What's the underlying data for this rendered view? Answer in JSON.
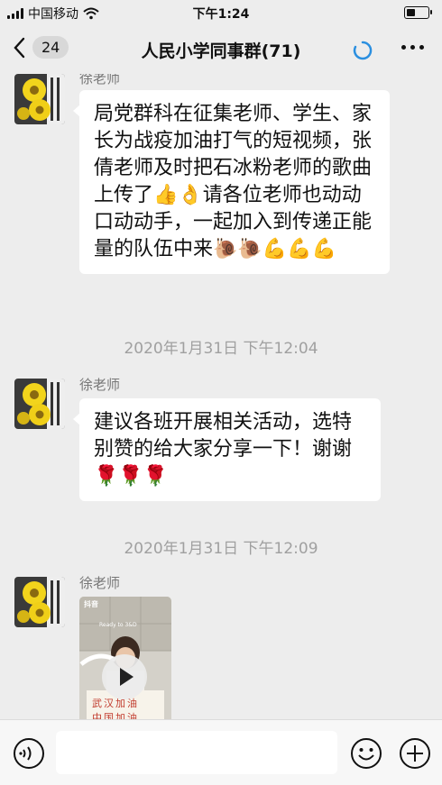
{
  "status_bar": {
    "carrier": "中国移动",
    "time": "下午1:24"
  },
  "nav": {
    "back_count": "24",
    "title": "人民小学同事群(71)"
  },
  "messages": [
    {
      "sender": "徐老师",
      "text": "局党群科在征集老师、学生、家长为战疫加油打气的短视频，张倩老师及时把石冰粉老师的歌曲上传了👍👌请各位老师也动动口动动手，一起加入到传递正能量的队伍中来🐌🐌💪💪💪"
    },
    {
      "timestamp": "2020年1月31日 下午12:04"
    },
    {
      "sender": "徐老师",
      "text": "建议各班开展相关活动，选特别赞的给大家分享一下！谢谢🌹🌹🌹"
    },
    {
      "timestamp": "2020年1月31日 下午12:09"
    },
    {
      "sender": "徐老师",
      "video": {
        "app_label": "抖音",
        "caption_top": "Ready to 3&D",
        "sign_line1": "武汉加油",
        "sign_line2": "中国加油"
      }
    }
  ],
  "input_bar": {
    "placeholder": ""
  },
  "colors": {
    "background": "#ededed",
    "bubble": "#ffffff",
    "timestamp": "#a0a0a0",
    "loading_accent": "#2a8fe0"
  }
}
